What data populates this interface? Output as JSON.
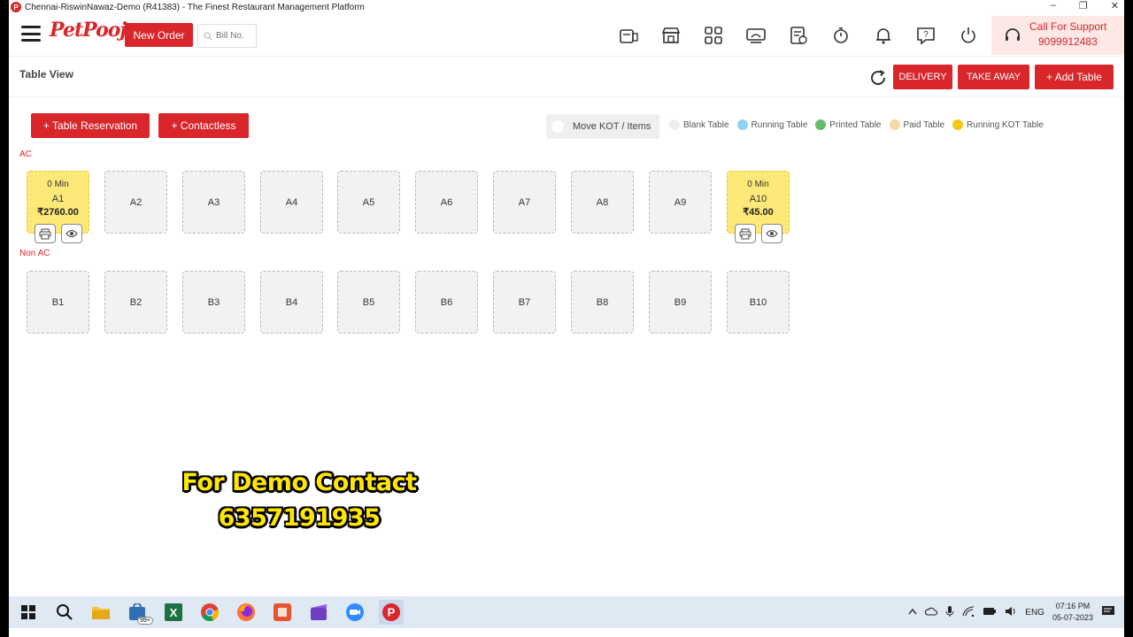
{
  "window": {
    "title": "Chennai-RiswinNawaz-Demo (R41383) - The Finest Restaurant Management Platform",
    "app_icon_letter": "P",
    "controls": [
      "–",
      "❐",
      "✕"
    ]
  },
  "header": {
    "logo": "PetPooja",
    "new_order_label": "New Order",
    "bill_placeholder": "Bill No.",
    "icons": [
      "delivery-box-icon",
      "store-icon",
      "grid-icon",
      "dine-in-icon",
      "reports-icon",
      "timer-icon",
      "bell-icon",
      "help-icon",
      "power-icon"
    ],
    "support_title": "Call For Support",
    "support_phone": "9099912483"
  },
  "subheader": {
    "title": "Table View",
    "delivery_label": "DELIVERY",
    "takeaway_label": "TAKE AWAY",
    "add_table_label": "+ Add Table"
  },
  "actions": {
    "table_reservation_label": "+ Table Reservation",
    "contactless_label": "+ Contactless",
    "move_kot_label": "Move KOT / Items"
  },
  "legend": [
    {
      "label": "Blank Table",
      "color": "#efefef"
    },
    {
      "label": "Running Table",
      "color": "#8fd3f4"
    },
    {
      "label": "Printed Table",
      "color": "#66bb6a"
    },
    {
      "label": "Paid Table",
      "color": "#f8d9a8"
    },
    {
      "label": "Running KOT Table",
      "color": "#f6c818"
    }
  ],
  "sections": [
    {
      "label": "AC",
      "tables": [
        {
          "name": "A1",
          "status": "running-kot",
          "time": "0 Min",
          "amount": "₹2760.00"
        },
        {
          "name": "A2",
          "status": "blank"
        },
        {
          "name": "A3",
          "status": "blank"
        },
        {
          "name": "A4",
          "status": "blank"
        },
        {
          "name": "A5",
          "status": "blank"
        },
        {
          "name": "A6",
          "status": "blank"
        },
        {
          "name": "A7",
          "status": "blank"
        },
        {
          "name": "A8",
          "status": "blank"
        },
        {
          "name": "A9",
          "status": "blank"
        },
        {
          "name": "A10",
          "status": "running-kot",
          "time": "0 Min",
          "amount": "₹45.00"
        }
      ]
    },
    {
      "label": "Non AC",
      "tables": [
        {
          "name": "B1",
          "status": "blank"
        },
        {
          "name": "B2",
          "status": "blank"
        },
        {
          "name": "B3",
          "status": "blank"
        },
        {
          "name": "B4",
          "status": "blank"
        },
        {
          "name": "B5",
          "status": "blank"
        },
        {
          "name": "B6",
          "status": "blank"
        },
        {
          "name": "B7",
          "status": "blank"
        },
        {
          "name": "B8",
          "status": "blank"
        },
        {
          "name": "B9",
          "status": "blank"
        },
        {
          "name": "B10",
          "status": "blank"
        }
      ]
    }
  ],
  "promo": {
    "line1": "For Demo Contact",
    "line2": "6357191935"
  },
  "taskbar": {
    "apps": [
      "windows-start-icon",
      "search-icon",
      "file-explorer-icon",
      "store-badge-icon",
      "excel-icon",
      "chrome-icon",
      "firefox-icon",
      "office-icon",
      "video-editor-icon",
      "zoom-icon",
      "petpooja-icon"
    ],
    "store_badge": "99+",
    "language": "ENG",
    "time": "07:16 PM",
    "date": "05-07-2023"
  }
}
